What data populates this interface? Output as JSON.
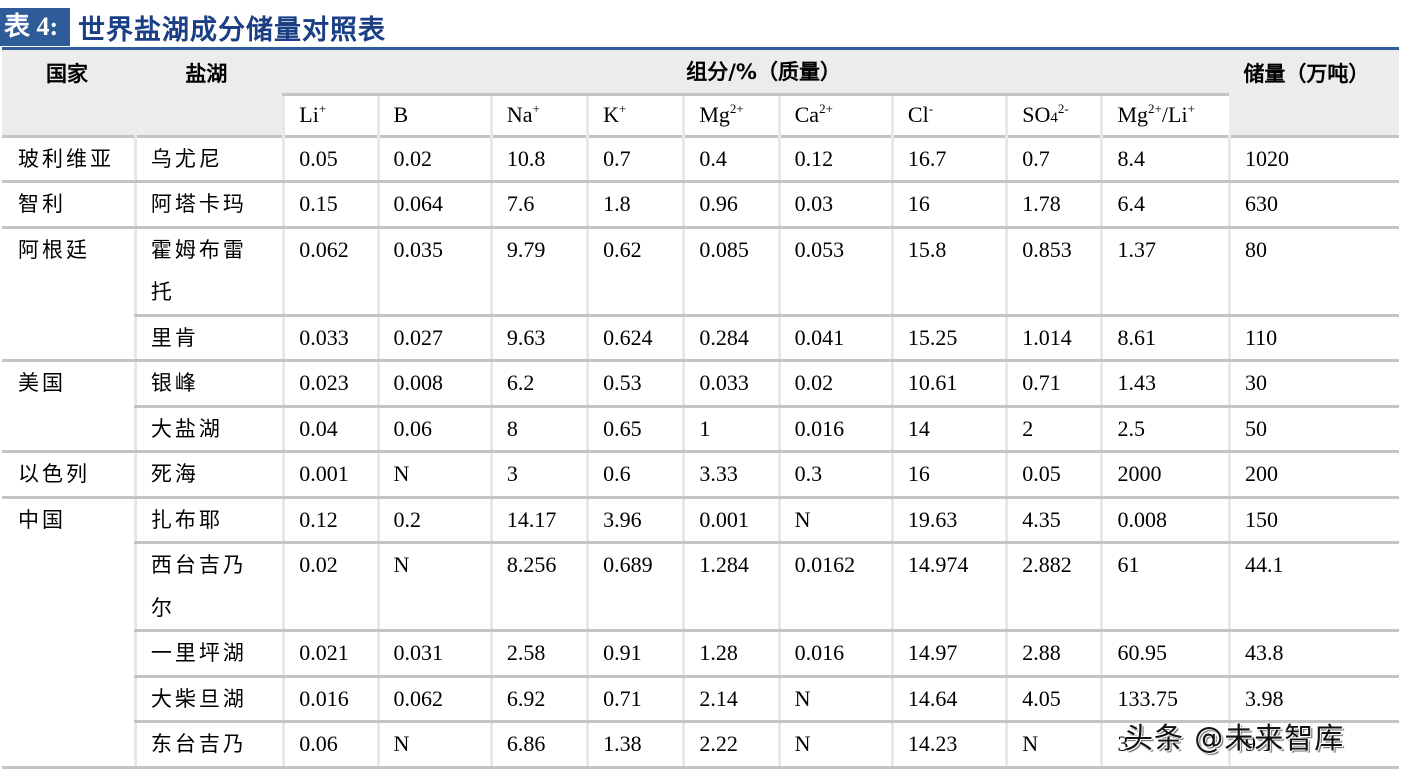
{
  "title": {
    "label": "表 4:",
    "text": "世界盐湖成分储量对照表"
  },
  "header": {
    "country": "国家",
    "lake": "盐湖",
    "composition_group": "组分/%（质量）",
    "reserves": "储量（万吨）",
    "components": [
      {
        "base": "Li",
        "sub": "",
        "sup": "+"
      },
      {
        "base": "B",
        "sub": "",
        "sup": ""
      },
      {
        "base": "Na",
        "sub": "",
        "sup": "+"
      },
      {
        "base": "K",
        "sub": "",
        "sup": "+"
      },
      {
        "base": "Mg",
        "sub": "",
        "sup": "2+"
      },
      {
        "base": "Ca",
        "sub": "",
        "sup": "2+"
      },
      {
        "base": "Cl",
        "sub": "",
        "sup": "-"
      },
      {
        "base": "SO",
        "sub": "4",
        "sup": "2-"
      },
      {
        "base": "Mg",
        "sub": "",
        "sup": "2+",
        "suffix": "/Li",
        "suffix_sup": "+"
      }
    ]
  },
  "groups": [
    {
      "country": "玻利维亚",
      "rows": [
        {
          "lake": "乌尤尼",
          "values": [
            "0.05",
            "0.02",
            "10.8",
            "0.7",
            "0.4",
            "0.12",
            "16.7",
            "0.7",
            "8.4",
            "1020"
          ]
        }
      ]
    },
    {
      "country": "智利",
      "rows": [
        {
          "lake": "阿塔卡玛",
          "values": [
            "0.15",
            "0.064",
            "7.6",
            "1.8",
            "0.96",
            "0.03",
            "16",
            "1.78",
            "6.4",
            "630"
          ]
        }
      ]
    },
    {
      "country": "阿根廷",
      "rows": [
        {
          "lake": "霍姆布雷托",
          "values": [
            "0.062",
            "0.035",
            "9.79",
            "0.62",
            "0.085",
            "0.053",
            "15.8",
            "0.853",
            "1.37",
            "80"
          ]
        },
        {
          "lake": "里肯",
          "values": [
            "0.033",
            "0.027",
            "9.63",
            "0.624",
            "0.284",
            "0.041",
            "15.25",
            "1.014",
            "8.61",
            "110"
          ]
        }
      ]
    },
    {
      "country": "美国",
      "rows": [
        {
          "lake": "银峰",
          "values": [
            "0.023",
            "0.008",
            "6.2",
            "0.53",
            "0.033",
            "0.02",
            "10.61",
            "0.71",
            "1.43",
            "30"
          ]
        },
        {
          "lake": "大盐湖",
          "values": [
            "0.04",
            "0.06",
            "8",
            "0.65",
            "1",
            "0.016",
            "14",
            "2",
            "2.5",
            "50"
          ]
        }
      ]
    },
    {
      "country": "以色列",
      "rows": [
        {
          "lake": "死海",
          "values": [
            "0.001",
            "N",
            "3",
            "0.6",
            "3.33",
            "0.3",
            "16",
            "0.05",
            "2000",
            "200"
          ]
        }
      ]
    },
    {
      "country": "中国",
      "rows": [
        {
          "lake": "扎布耶",
          "values": [
            "0.12",
            "0.2",
            "14.17",
            "3.96",
            "0.001",
            "N",
            "19.63",
            "4.35",
            "0.008",
            "150"
          ]
        },
        {
          "lake": "西台吉乃尔",
          "values": [
            "0.02",
            "N",
            "8.256",
            "0.689",
            "1.284",
            "0.0162",
            "14.974",
            "2.882",
            "61",
            "44.1"
          ]
        },
        {
          "lake": "一里坪湖",
          "values": [
            "0.021",
            "0.031",
            "2.58",
            "0.91",
            "1.28",
            "0.016",
            "14.97",
            "2.88",
            "60.95",
            "43.8"
          ]
        },
        {
          "lake": "大柴旦湖",
          "values": [
            "0.016",
            "0.062",
            "6.92",
            "0.71",
            "2.14",
            "N",
            "14.64",
            "4.05",
            "133.75",
            "3.98"
          ]
        },
        {
          "lake": "东台吉乃",
          "values": [
            "0.06",
            "N",
            "6.86",
            "1.38",
            "2.22",
            "N",
            "14.23",
            "N",
            "37",
            "9.1"
          ]
        }
      ]
    }
  ],
  "watermark": "头条 @未来智库"
}
